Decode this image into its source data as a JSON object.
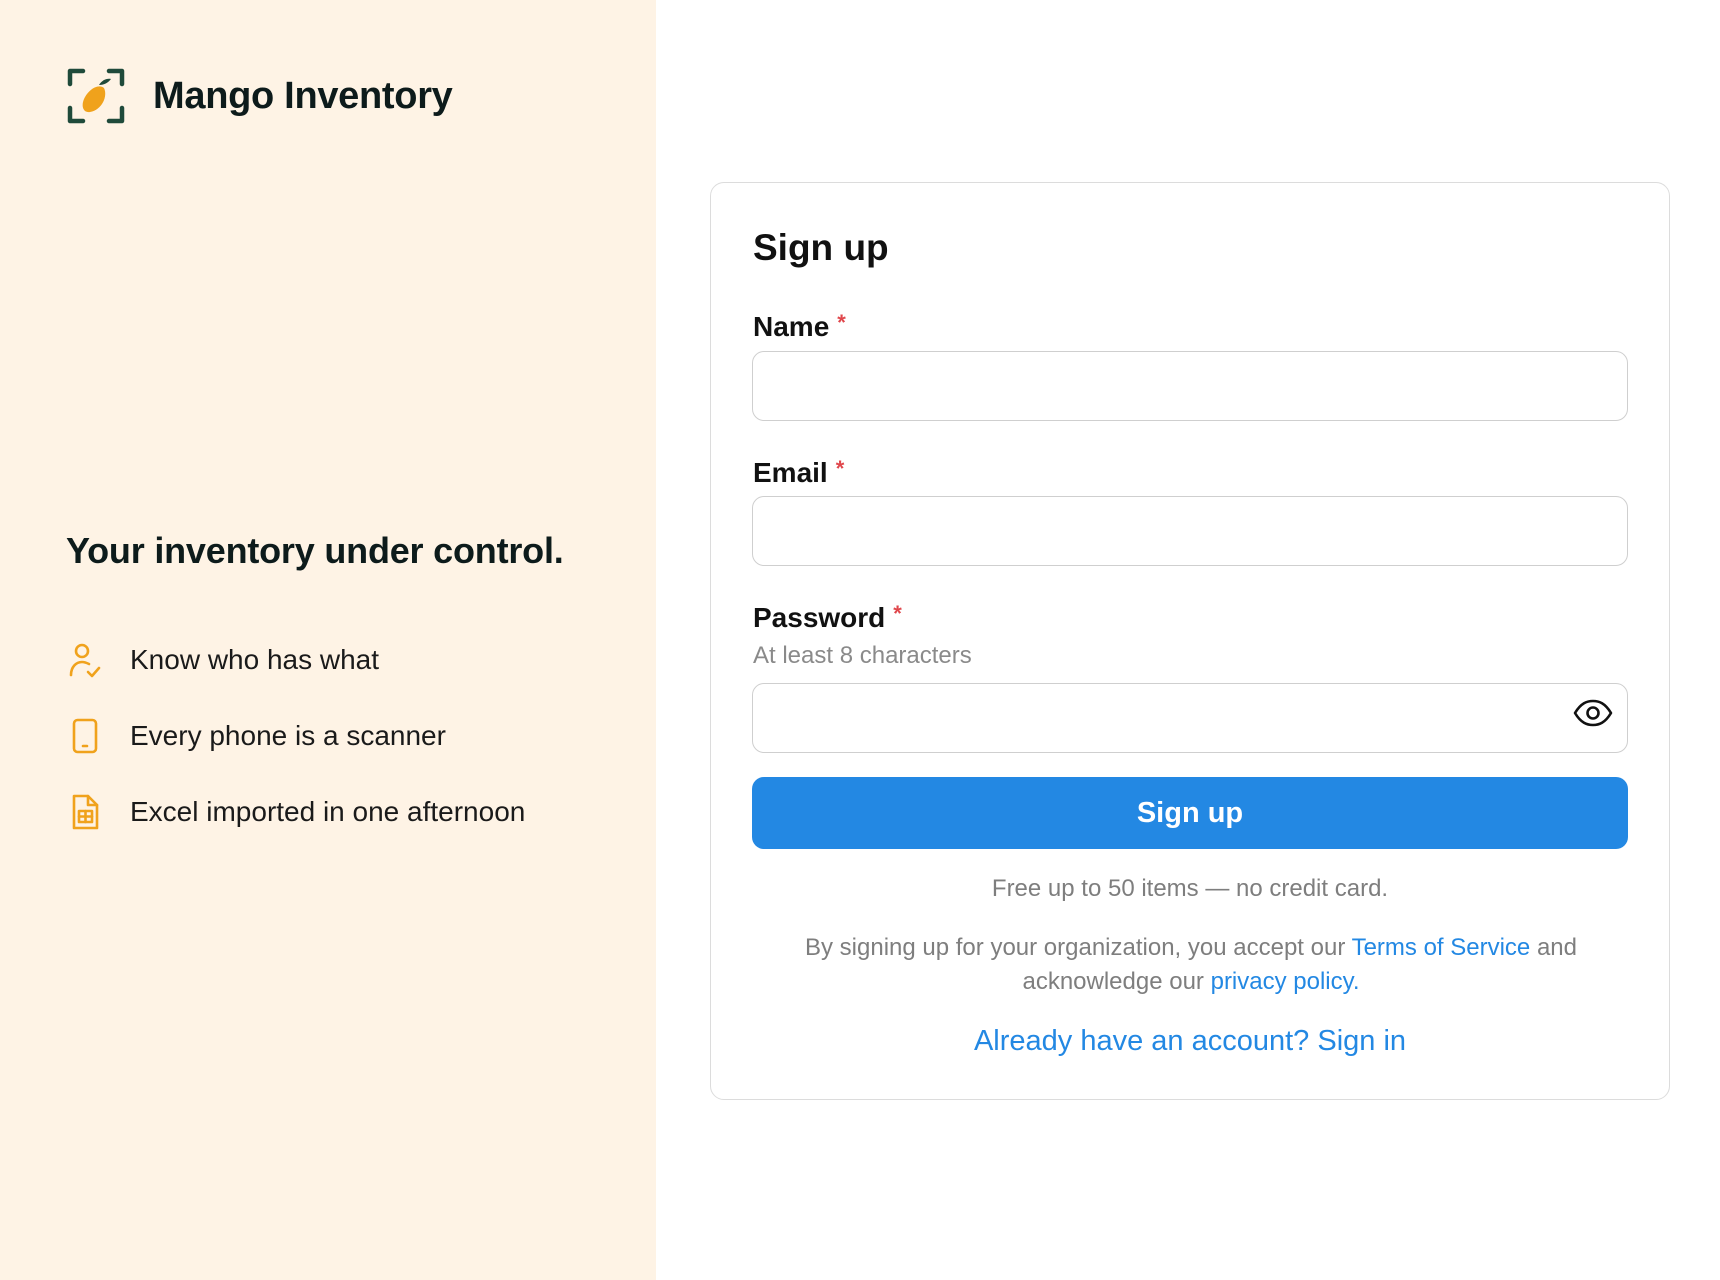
{
  "brand": {
    "name": "Mango Inventory",
    "logo_icon": "mango-scanner-logo-icon"
  },
  "marketing": {
    "headline": "Your inventory under control.",
    "features": [
      {
        "icon": "user-check-icon",
        "text": "Know who has what"
      },
      {
        "icon": "phone-icon",
        "text": "Every phone is a scanner"
      },
      {
        "icon": "spreadsheet-file-icon",
        "text": "Excel imported in one afternoon"
      }
    ]
  },
  "form": {
    "title": "Sign up",
    "required_mark": "*",
    "name": {
      "label": "Name",
      "value": "",
      "placeholder": ""
    },
    "email": {
      "label": "Email",
      "value": "",
      "placeholder": ""
    },
    "password": {
      "label": "Password",
      "hint": "At least 8 characters",
      "value": "",
      "placeholder": "",
      "toggle_icon": "eye-icon"
    },
    "submit_label": "Sign up",
    "free_note": "Free up to 50 items — no credit card.",
    "terms": {
      "prefix": "By signing up for your organization, you accept our ",
      "tos_link": "Terms of Service",
      "middle": " and acknowledge our ",
      "privacy_link": "privacy policy",
      "suffix": "."
    },
    "signin_link": "Already have an account? Sign in"
  },
  "colors": {
    "left_panel_bg": "#fef3e5",
    "accent_blue": "#2388e3",
    "logo_green": "#1f4a3a",
    "mango_orange": "#f0a21c",
    "icon_orange": "#f0a21c",
    "required_red": "#e0474c"
  }
}
